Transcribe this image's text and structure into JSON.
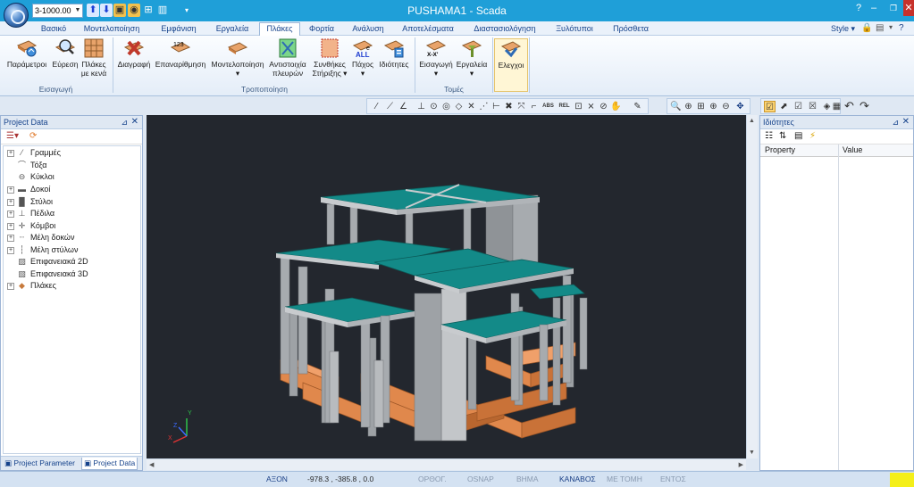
{
  "window": {
    "title": "PUSHAMA1 - Scada",
    "scale_combo": "3-1000.00"
  },
  "tabs": [
    {
      "label": "Βασικό"
    },
    {
      "label": "Μοντελοποίηση"
    },
    {
      "label": "Εμφάνιση"
    },
    {
      "label": "Εργαλεία"
    },
    {
      "label": "Πλάκες"
    },
    {
      "label": "Φορτία"
    },
    {
      "label": "Ανάλυση"
    },
    {
      "label": "Αποτελέσματα"
    },
    {
      "label": "Διαστασιολόγηση"
    },
    {
      "label": "Ξυλότυποι"
    },
    {
      "label": "Πρόσθετα"
    }
  ],
  "active_tab": "Πλάκες",
  "style_label": "Style",
  "ribbon": {
    "groups": [
      {
        "label": "Εισαγωγή"
      },
      {
        "label": "Τροποποίηση"
      },
      {
        "label": "Τομές"
      }
    ],
    "buttons": [
      {
        "l1": "Παράμετροι",
        "l2": ""
      },
      {
        "l1": "Εύρεση",
        "l2": ""
      },
      {
        "l1": "Πλάκες",
        "l2": "με κενά"
      },
      {
        "l1": "Διαγραφή",
        "l2": ""
      },
      {
        "l1": "Επαναρίθμηση",
        "l2": ""
      },
      {
        "l1": "Μοντελοποίηση",
        "l2": "▾"
      },
      {
        "l1": "Αντιστοιχία",
        "l2": "πλευρών"
      },
      {
        "l1": "Συνθήκες",
        "l2": "Στήριξης ▾"
      },
      {
        "l1": "Πάχος",
        "l2": "▾"
      },
      {
        "l1": "Ιδιότητες",
        "l2": ""
      },
      {
        "l1": "Εισαγωγή",
        "l2": "▾"
      },
      {
        "l1": "Εργαλεία",
        "l2": "▾"
      },
      {
        "l1": "Ελεγχοι",
        "l2": ""
      }
    ],
    "icon_text": {
      "abs": "ABS",
      "rel": "REL",
      "all": "ALL",
      "xx": "X-X'",
      "e": "e",
      "n123": "123"
    }
  },
  "left_panel": {
    "title": "Project Data",
    "tree": [
      {
        "label": "Γραμμές",
        "icon": "line-icon",
        "expandable": true
      },
      {
        "label": "Τόξα",
        "icon": "arc-icon",
        "expandable": false
      },
      {
        "label": "Κύκλοι",
        "icon": "circle-icon",
        "expandable": false
      },
      {
        "label": "Δοκοί",
        "icon": "beam-icon",
        "expandable": true
      },
      {
        "label": "Στύλοι",
        "icon": "column-icon",
        "expandable": true
      },
      {
        "label": "Πέδιλα",
        "icon": "footing-icon",
        "expandable": true
      },
      {
        "label": "Κόμβοι",
        "icon": "node-icon",
        "expandable": true
      },
      {
        "label": "Μέλη δοκών",
        "icon": "beam-member-icon",
        "expandable": true
      },
      {
        "label": "Μέλη στύλων",
        "icon": "column-member-icon",
        "expandable": true
      },
      {
        "label": "Επιφανειακά 2D",
        "icon": "surface-2d-icon",
        "expandable": false
      },
      {
        "label": "Επιφανειακά 3D",
        "icon": "surface-3d-icon",
        "expandable": false
      },
      {
        "label": "Πλάκες",
        "icon": "slab-icon",
        "expandable": true
      }
    ],
    "bottom_tabs": [
      {
        "label": "Project Parameter"
      },
      {
        "label": "Project Data"
      }
    ]
  },
  "right_panel": {
    "title": "Ιδιότητες",
    "col_property": "Property",
    "col_value": "Value"
  },
  "axes": {
    "x": "X",
    "y": "Y",
    "z": "Z"
  },
  "statusbar": {
    "axon": "ΑΞΟΝ",
    "coords": "-978.3 , -385.8 , 0.0",
    "toggles": [
      {
        "label": "ΟΡΘΟΓ.",
        "on": false
      },
      {
        "label": "OSNAP",
        "on": false
      },
      {
        "label": "ΒΗΜΑ",
        "on": false
      },
      {
        "label": "ΚΑΝΑΒΟΣ",
        "on": true
      },
      {
        "label": "ΜΕ ΤΟΜΗ",
        "on": false
      },
      {
        "label": "ΕΝΤΟΣ",
        "on": false
      }
    ]
  },
  "colors": {
    "titlebar": "#1f9fd8",
    "viewport_bg": "#23272e",
    "slab_top": "#138a88",
    "column": "#a7abaf",
    "footing": "#e0884c"
  }
}
